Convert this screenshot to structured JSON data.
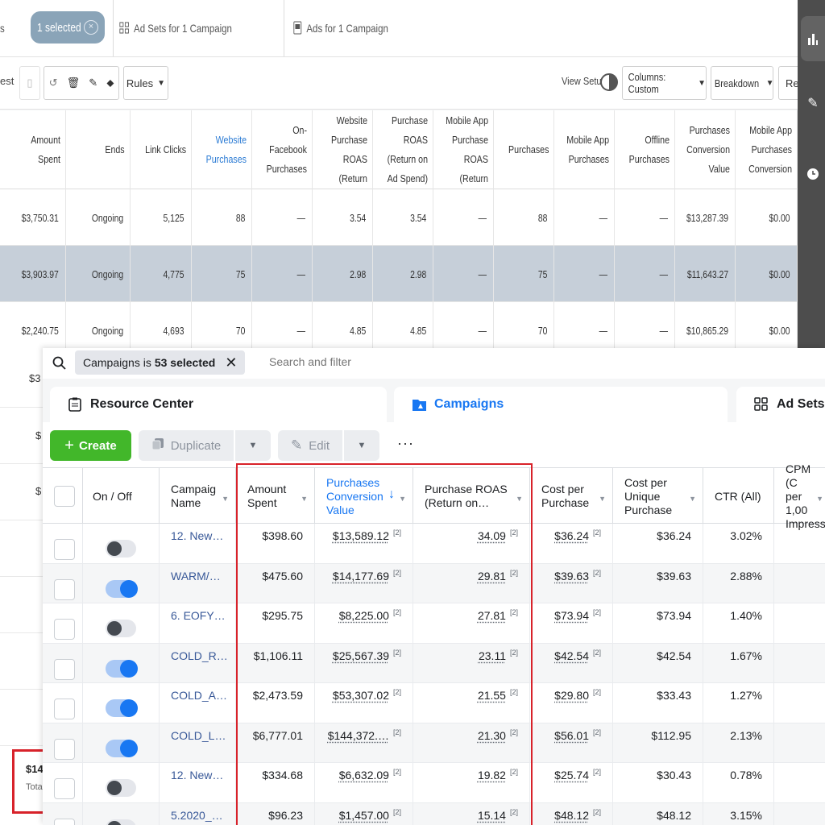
{
  "back": {
    "tabs": {
      "partial_left": "s",
      "selected_pill": "1 selected",
      "ad_sets_tab": "Ad Sets for 1 Campaign",
      "ads_tab": "Ads for 1 Campaign"
    },
    "toolbar": {
      "partial_left": "est",
      "rules_label": "Rules",
      "view_setup_label": "View Setup",
      "columns_label": "Columns: Custom",
      "breakdown_label": "Breakdown",
      "partial_right": "Re"
    },
    "columns": [
      "Amount Spent",
      "Ends",
      "Link Clicks",
      "Website Purchases",
      "On-Facebook Purchases",
      "Website Purchase ROAS (Return",
      "Purchase ROAS (Return on Ad Spend)",
      "Mobile App Purchase ROAS (Return",
      "Purchases",
      "Mobile App Purchases",
      "Offline Purchases",
      "Purchases Conversion Value",
      "Mobile App Purchases Conversion"
    ],
    "rows": [
      [
        "$3,750.31",
        "Ongoing",
        "5,125",
        "88",
        "—",
        "3.54",
        "3.54",
        "—",
        "88",
        "—",
        "—",
        "$13,287.39",
        "$0.00"
      ],
      [
        "$3,903.97",
        "Ongoing",
        "4,775",
        "75",
        "—",
        "2.98",
        "2.98",
        "—",
        "75",
        "—",
        "—",
        "$11,643.27",
        "$0.00"
      ],
      [
        "$2,240.75",
        "Ongoing",
        "4,693",
        "70",
        "—",
        "4.85",
        "4.85",
        "—",
        "70",
        "—",
        "—",
        "$10,865.29",
        "$0.00"
      ]
    ],
    "left_strip": [
      "$3",
      "$",
      "$"
    ],
    "total_partial": {
      "value": "$14",
      "label": "Tota"
    }
  },
  "front": {
    "search": {
      "chip_prefix": "Campaigns is",
      "chip_count": "53 selected",
      "placeholder": "Search and filter"
    },
    "tabs": [
      "Resource Center",
      "Campaigns",
      "Ad Sets"
    ],
    "actions": {
      "create": "Create",
      "duplicate": "Duplicate",
      "edit": "Edit",
      "more": "···"
    },
    "columns": [
      "On / Off",
      "Campaig Name",
      "Amount Spent",
      "Purchases Conversion Value",
      "Purchase ROAS (Return on…",
      "Cost per Purchase",
      "Cost per Unique Purchase",
      "CTR (All)",
      "CPM (C per 1,00 Impress"
    ],
    "footnote": "[2]",
    "rows": [
      {
        "on": false,
        "name": "12. New…",
        "spent": "$398.60",
        "conv": "$13,589.12",
        "roas": "34.09",
        "cpp": "$36.24",
        "cpu": "$36.24",
        "ctr": "3.02%"
      },
      {
        "on": true,
        "name": "WARM/…",
        "spent": "$475.60",
        "conv": "$14,177.69",
        "roas": "29.81",
        "cpp": "$39.63",
        "cpu": "$39.63",
        "ctr": "2.88%"
      },
      {
        "on": false,
        "name": "6. EOFY…",
        "spent": "$295.75",
        "conv": "$8,225.00",
        "roas": "27.81",
        "cpp": "$73.94",
        "cpu": "$73.94",
        "ctr": "1.40%"
      },
      {
        "on": true,
        "name": "COLD_R…",
        "spent": "$1,106.11",
        "conv": "$25,567.39",
        "roas": "23.11",
        "cpp": "$42.54",
        "cpu": "$42.54",
        "ctr": "1.67%"
      },
      {
        "on": true,
        "name": "COLD_A…",
        "spent": "$2,473.59",
        "conv": "$53,307.02",
        "roas": "21.55",
        "cpp": "$29.80",
        "cpu": "$33.43",
        "ctr": "1.27%"
      },
      {
        "on": true,
        "name": "COLD_L…",
        "spent": "$6,777.01",
        "conv": "$144,372.…",
        "roas": "21.30",
        "cpp": "$56.01",
        "cpu": "$112.95",
        "ctr": "2.13%"
      },
      {
        "on": false,
        "name": "12. New…",
        "spent": "$334.68",
        "conv": "$6,632.09",
        "roas": "19.82",
        "cpp": "$25.74",
        "cpu": "$30.43",
        "ctr": "0.78%"
      },
      {
        "on": false,
        "name": "5.2020_…",
        "spent": "$96.23",
        "conv": "$1,457.00",
        "roas": "15.14",
        "cpp": "$48.12",
        "cpu": "$48.12",
        "ctr": "3.15%"
      }
    ]
  },
  "colors": {
    "accent_blue": "#1877f2",
    "create_green": "#42b72a",
    "highlight_red": "#d8222a",
    "selected_row": "#c6cfd9"
  }
}
